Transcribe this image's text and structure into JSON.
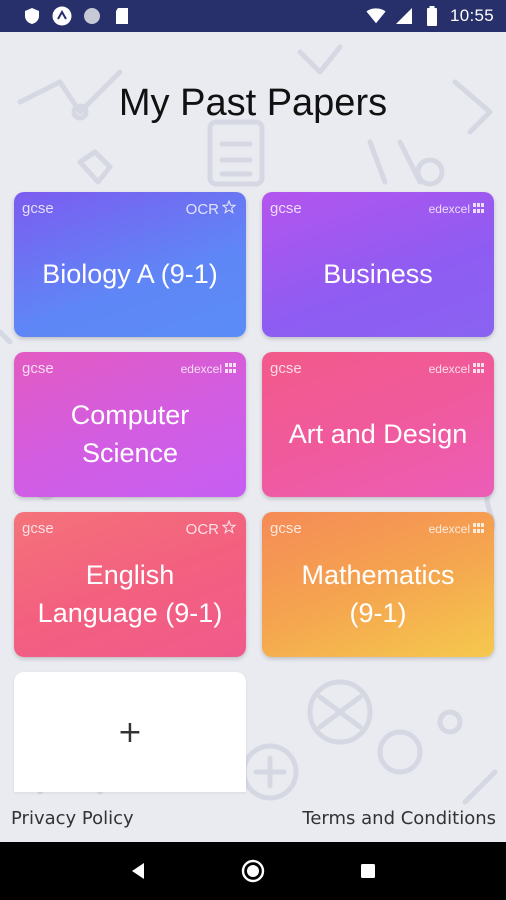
{
  "status_bar": {
    "time": "10:55",
    "left_icons": [
      "shield-icon",
      "notification-a-icon",
      "circle-icon",
      "sd-card-icon"
    ],
    "right_icons": [
      "wifi-icon",
      "signal-icon",
      "battery-icon"
    ]
  },
  "page": {
    "title": "My Past Papers"
  },
  "cards": [
    {
      "level": "gcse",
      "board": "OCR",
      "subject": "Biology A (9-1)",
      "color_from": "#7c5cf0",
      "color_to": "#5a8cf7"
    },
    {
      "level": "gcse",
      "board": "edexcel",
      "subject": "Business",
      "color_from": "#b455ee",
      "color_to": "#8a63f1"
    },
    {
      "level": "gcse",
      "board": "edexcel",
      "subject_line1": "Computer",
      "subject_line2": "Science",
      "color_from": "#e35ac2",
      "color_to": "#c65ef3"
    },
    {
      "level": "gcse",
      "board": "edexcel",
      "subject": "Art and Design",
      "color_from": "#f25a8a",
      "color_to": "#ec5db8"
    },
    {
      "level": "gcse",
      "board": "OCR",
      "subject_line1": "English",
      "subject_line2": "Language (9-1)",
      "color_from": "#f4737a",
      "color_to": "#f05a8c"
    },
    {
      "level": "gcse",
      "board": "edexcel",
      "subject_line1": "Mathematics",
      "subject_line2": "(9-1)",
      "color_from": "#f58b57",
      "color_to": "#f5c94e"
    }
  ],
  "add_card": {
    "label": "+"
  },
  "footer": {
    "privacy": "Privacy Policy",
    "terms": "Terms and Conditions"
  },
  "nav_bar": {
    "buttons": [
      "back-icon",
      "home-icon",
      "recents-icon"
    ]
  },
  "colors": {
    "status_bar_bg": "#27306a",
    "app_bg": "#e9ebf1",
    "nav_bg": "#000000"
  }
}
